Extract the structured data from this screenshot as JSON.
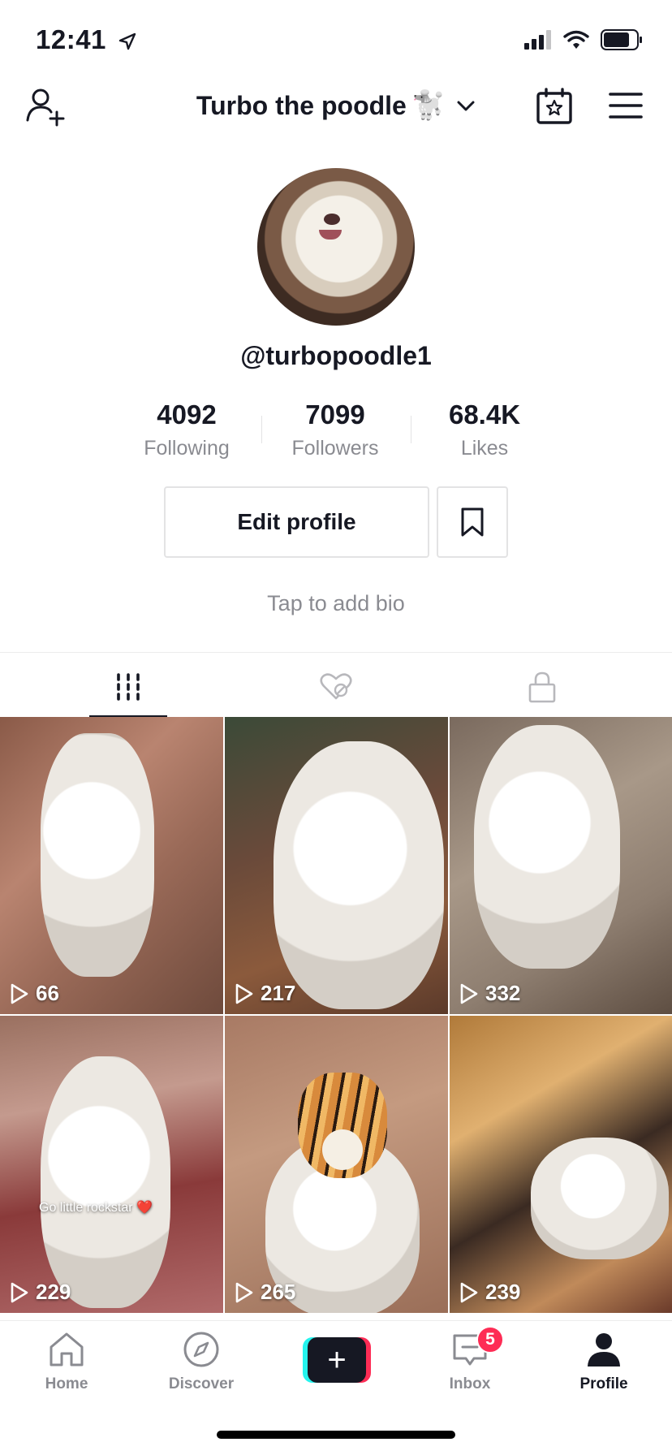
{
  "status_bar": {
    "time": "12:41"
  },
  "header": {
    "account_name": "Turbo the poodle",
    "account_emoji": "🐩"
  },
  "profile": {
    "username": "@turbopoodle1",
    "stats": [
      {
        "value": "4092",
        "label": "Following"
      },
      {
        "value": "7099",
        "label": "Followers"
      },
      {
        "value": "68.4K",
        "label": "Likes"
      }
    ],
    "edit_profile_label": "Edit profile",
    "bio_placeholder": "Tap to add bio"
  },
  "tabs": [
    {
      "icon": "grid-icon",
      "active": true
    },
    {
      "icon": "liked-hidden-icon",
      "active": false
    },
    {
      "icon": "lock-icon",
      "active": false
    }
  ],
  "videos": [
    {
      "views": "66",
      "caption": ""
    },
    {
      "views": "217",
      "caption": ""
    },
    {
      "views": "332",
      "caption": ""
    },
    {
      "views": "229",
      "caption": "Go little rockstar ❤️"
    },
    {
      "views": "265",
      "caption": ""
    },
    {
      "views": "239",
      "caption": ""
    }
  ],
  "bottom_nav": {
    "home": "Home",
    "discover": "Discover",
    "create": "+",
    "inbox": "Inbox",
    "inbox_badge": "5",
    "profile": "Profile"
  },
  "colors": {
    "accent": "#fe2c55",
    "cyan": "#25f4ee",
    "text": "#161823",
    "muted": "#8a8b91"
  }
}
